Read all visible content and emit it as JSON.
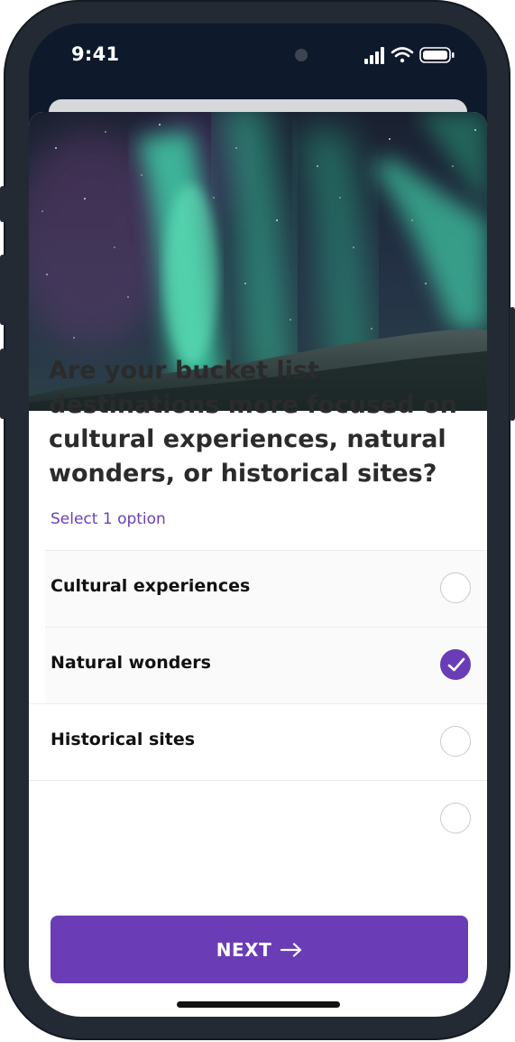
{
  "status_bar": {
    "time": "9:41",
    "icons": [
      "signal-icon",
      "wifi-icon",
      "battery-icon"
    ]
  },
  "hero": {
    "image": "northern-lights-photo"
  },
  "question": {
    "text": "Are your bucket list destinations more focused on cultural experiences, natural wonders, or historical sites?",
    "hint": "Select 1 option"
  },
  "options": [
    {
      "label": "Cultural experiences",
      "selected": false
    },
    {
      "label": "Natural wonders",
      "selected": true
    },
    {
      "label": "Historical sites",
      "selected": false
    }
  ],
  "next_button": {
    "label": "NEXT",
    "icon": "arrow-right-icon"
  },
  "colors": {
    "accent": "#6a3db6",
    "hint": "#6b3fb8",
    "frame": "#232a34"
  }
}
